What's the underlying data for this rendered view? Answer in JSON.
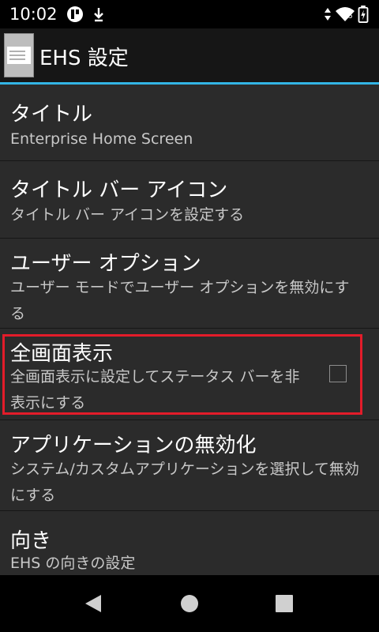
{
  "status_bar": {
    "time": "10:02",
    "signal_badge": "5",
    "left_icons": [
      "notification-app-icon",
      "download-arrow-icon"
    ],
    "right_icons": [
      "data-arrows-icon",
      "wifi-icon",
      "battery-charging-icon"
    ]
  },
  "action_bar": {
    "title": "EHS 設定",
    "app_icon": "ehs-app-icon"
  },
  "accent_color": "#33b5e5",
  "highlight_color": "#e31c2a",
  "settings": [
    {
      "title": "タイトル",
      "summary": "Enterprise Home Screen"
    },
    {
      "title": "タイトル バー アイコン",
      "summary": "タイトル バー アイコンを設定する"
    },
    {
      "title": "ユーザー オプション",
      "summary": "ユーザー モードでユーザー オプションを無効にする"
    },
    {
      "title": "全画面表示",
      "summary": "全画面表示に設定してステータス バーを非表示にする",
      "checked": false
    },
    {
      "title": "アプリケーションの無効化",
      "summary": "システム/カスタムアプリケーションを選択して無効にする"
    },
    {
      "title": "向き",
      "summary": "EHS の向きの設定"
    }
  ],
  "nav_bar": {
    "buttons": [
      "back-icon",
      "home-icon",
      "recents-icon"
    ]
  }
}
